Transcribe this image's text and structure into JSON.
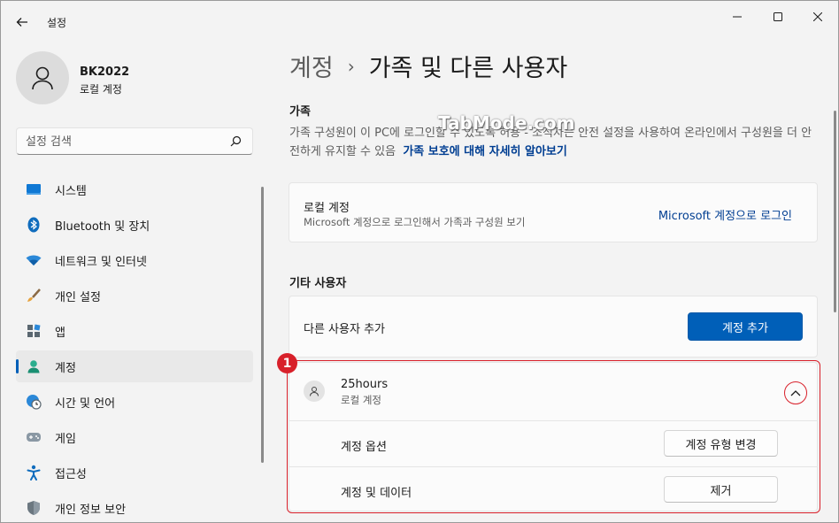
{
  "window": {
    "title": "설정"
  },
  "profile": {
    "name": "BK2022",
    "account_type": "로컬 계정"
  },
  "search": {
    "placeholder": "설정 검색"
  },
  "nav": {
    "items": [
      {
        "label": "시스템",
        "icon": "system-icon"
      },
      {
        "label": "Bluetooth 및 장치",
        "icon": "bluetooth-icon"
      },
      {
        "label": "네트워크 및 인터넷",
        "icon": "wifi-icon"
      },
      {
        "label": "개인 설정",
        "icon": "brush-icon"
      },
      {
        "label": "앱",
        "icon": "apps-icon"
      },
      {
        "label": "계정",
        "icon": "account-icon",
        "selected": true
      },
      {
        "label": "시간 및 언어",
        "icon": "globe-clock-icon"
      },
      {
        "label": "게임",
        "icon": "gamepad-icon"
      },
      {
        "label": "접근성",
        "icon": "accessibility-icon"
      },
      {
        "label": "개인 정보 보안",
        "icon": "shield-icon"
      }
    ]
  },
  "breadcrumb": {
    "parent": "계정",
    "separator": "›",
    "current": "가족 및 다른 사용자"
  },
  "family": {
    "heading": "가족",
    "description": "가족 구성원이 이 PC에 로그인할 수 있도록 허용 - 조직자는 안전 설정을 사용하여 온라인에서 구성원을 더 안전하게 유지할 수 있음",
    "learn_more": "가족 보호에 대해 자세히 알아보기",
    "local_card": {
      "title": "로컬 계정",
      "subtitle": "Microsoft 계정으로 로그인해서 가족과 구성원 보기",
      "link": "Microsoft 계정으로 로그인"
    }
  },
  "other_users": {
    "heading": "기타 사용자",
    "add_label": "다른 사용자 추가",
    "add_button": "계정 추가",
    "user": {
      "name": "25hours",
      "type": "로컬 계정",
      "options_label": "계정 옵션",
      "change_type_button": "계정 유형 변경",
      "data_label": "계정 및 데이터",
      "remove_button": "제거"
    }
  },
  "annotation": {
    "badge": "1"
  },
  "watermark": "TabMode.com",
  "colors": {
    "accent": "#005fb8",
    "link": "#003e92",
    "annotation": "#d8202a"
  }
}
